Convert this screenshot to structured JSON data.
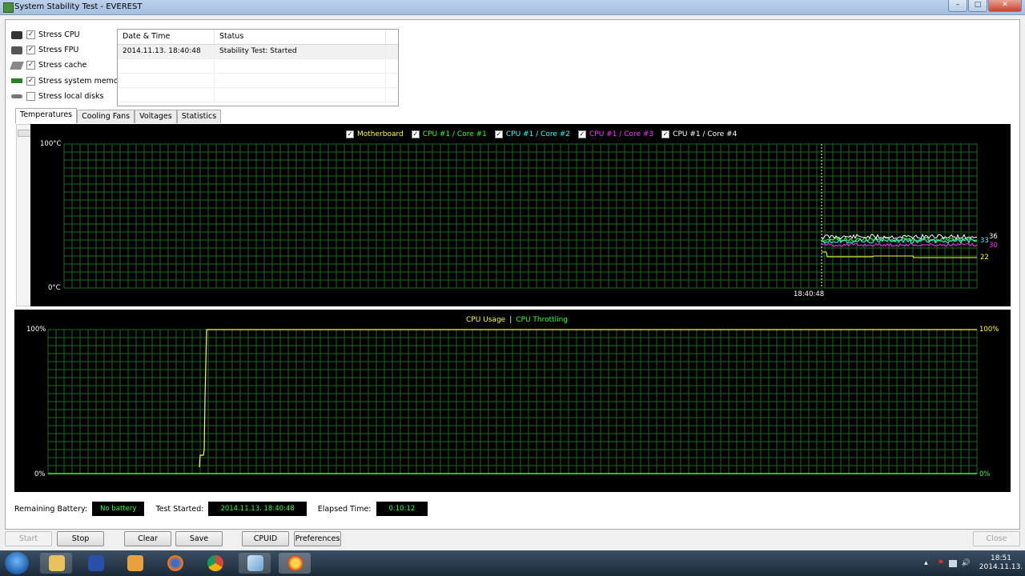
{
  "window": {
    "title": "System Stability Test - EVEREST",
    "buttons": {
      "minimize": "–",
      "maximize": "□",
      "close": "✕"
    }
  },
  "stress_options": [
    {
      "label": "Stress CPU",
      "checked": true,
      "icon": "cpu-icon",
      "check_mark": "✓"
    },
    {
      "label": "Stress FPU",
      "checked": true,
      "icon": "fpu-icon",
      "check_mark": "✓"
    },
    {
      "label": "Stress cache",
      "checked": true,
      "icon": "cache-icon",
      "check_mark": "✓"
    },
    {
      "label": "Stress system memory",
      "checked": true,
      "icon": "memory-icon",
      "check_mark": "✓"
    },
    {
      "label": "Stress local disks",
      "checked": false,
      "icon": "disk-icon",
      "check_mark": ""
    }
  ],
  "log": {
    "headers": [
      "Date & Time",
      "Status"
    ],
    "rows": [
      [
        "2014.11.13. 18:40:48",
        "Stability Test: Started"
      ],
      [
        "",
        ""
      ],
      [
        "",
        ""
      ],
      [
        "",
        ""
      ]
    ]
  },
  "tabs": [
    "Temperatures",
    "Cooling Fans",
    "Voltages",
    "Statistics"
  ],
  "active_tab": "Temperatures",
  "temperature_chart": {
    "check_mark": "✓",
    "legend": [
      {
        "name": "Motherboard",
        "color": "#ffff33"
      },
      {
        "name": "CPU #1 / Core #1",
        "color": "#33ff33"
      },
      {
        "name": "CPU #1 / Core #2",
        "color": "#33ffff"
      },
      {
        "name": "CPU #1 / Core #3",
        "color": "#ff33ff"
      },
      {
        "name": "CPU #1 / Core #4",
        "color": "#ffffff"
      }
    ],
    "y_top_label": "100",
    "y_bottom_label": "0",
    "unit": "°C",
    "time_label": "18:40:48",
    "value_labels": [
      {
        "text": "36",
        "color": "#ffffff"
      },
      {
        "text": "33",
        "color": "#33ffff"
      },
      {
        "text": "30",
        "color": "#ff33ff"
      },
      {
        "text": "22",
        "color": "#ffff33"
      }
    ]
  },
  "cpu_chart": {
    "legend": [
      {
        "name": "CPU Usage",
        "color": "#ffff33"
      },
      {
        "name": "CPU Throttling",
        "color": "#33ff33"
      }
    ],
    "separator": "|",
    "y_top_left": "100%",
    "y_bottom_left": "0%",
    "y_top_right": "100%",
    "y_bottom_right": "0%"
  },
  "status": {
    "battery_label": "Remaining Battery:",
    "battery_value": "No battery",
    "started_label": "Test Started:",
    "started_value": "2014.11.13. 18:40:48",
    "elapsed_label": "Elapsed Time:",
    "elapsed_value": "0:10:12"
  },
  "buttons": {
    "start": "Start",
    "stop": "Stop",
    "clear": "Clear",
    "save": "Save",
    "cpuid": "CPUID",
    "preferences": "Preferences",
    "close": "Close"
  },
  "taskbar": {
    "time": "18:51",
    "date": "2014.11.13.",
    "apps": [
      "explorer-icon",
      "save-icon",
      "media-player-icon",
      "firefox-icon",
      "chrome-icon",
      "file-icon",
      "everest-icon"
    ],
    "tray_arrow": "▴",
    "tray_flag": "⚑",
    "tray_volume": "🔊"
  },
  "colors": {
    "grid": "#1d6b1d",
    "chart_bg": "#000000",
    "accent_green": "#33ff33"
  }
}
